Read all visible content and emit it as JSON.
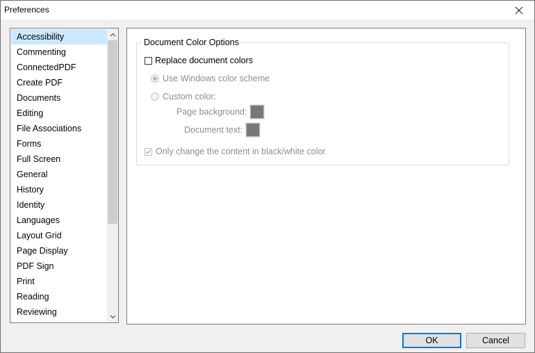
{
  "window": {
    "title": "Preferences"
  },
  "nav": {
    "items": [
      {
        "label": "Accessibility",
        "selected": true
      },
      {
        "label": "Commenting"
      },
      {
        "label": "ConnectedPDF"
      },
      {
        "label": "Create PDF"
      },
      {
        "label": "Documents"
      },
      {
        "label": "Editing"
      },
      {
        "label": "File Associations"
      },
      {
        "label": "Forms"
      },
      {
        "label": "Full Screen"
      },
      {
        "label": "General"
      },
      {
        "label": "History"
      },
      {
        "label": "Identity"
      },
      {
        "label": "Languages"
      },
      {
        "label": "Layout Grid"
      },
      {
        "label": "Page Display"
      },
      {
        "label": "PDF Sign"
      },
      {
        "label": "Print"
      },
      {
        "label": "Reading"
      },
      {
        "label": "Reviewing"
      }
    ]
  },
  "panel": {
    "group_title": "Document Color Options",
    "replace_colors": {
      "label": "Replace document colors",
      "checked": false
    },
    "use_windows_scheme": {
      "label": "Use Windows color scheme",
      "selected": true,
      "enabled": false
    },
    "custom_color": {
      "label": "Custom color:",
      "selected": false,
      "enabled": false
    },
    "page_background": {
      "label": "Page background:",
      "color": "#787878"
    },
    "document_text": {
      "label": "Document text:",
      "color": "#787878"
    },
    "only_bw": {
      "label": "Only change the content in black/white color",
      "checked": true,
      "enabled": false
    }
  },
  "buttons": {
    "ok": "OK",
    "cancel": "Cancel"
  },
  "colors": {
    "selection": "#cce8ff",
    "default_button_border": "#0078d7"
  }
}
